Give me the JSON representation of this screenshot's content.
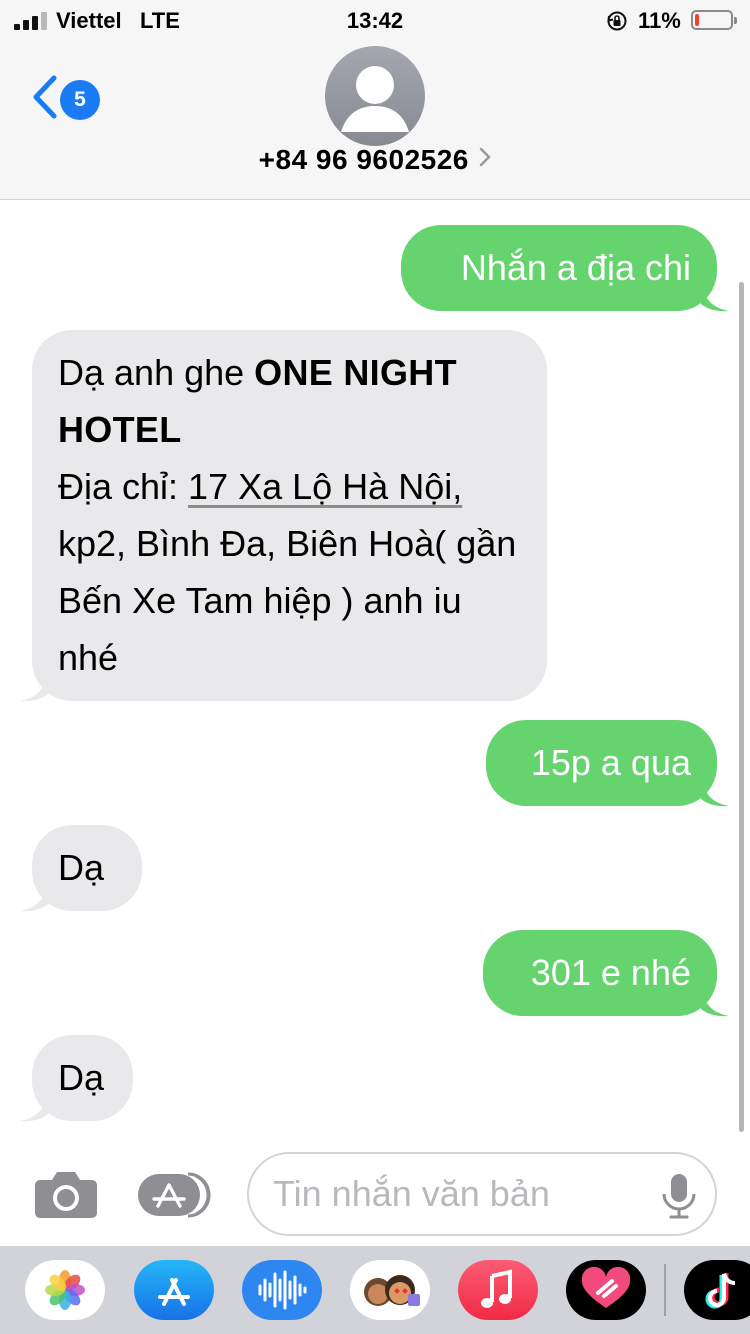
{
  "status_bar": {
    "carrier": "Viettel",
    "network": "LTE",
    "time": "13:42",
    "battery_percent": "11%",
    "battery_level": 0.11,
    "battery_color": "#ff3b30",
    "signal_bars": 3,
    "icons": [
      "signal-icon",
      "orientation-lock-icon",
      "battery-icon"
    ]
  },
  "header": {
    "back_badge_count": "5",
    "contact_name": "+84 96 9602526",
    "accent_color": "#1a7cf5",
    "icons": [
      "back-chevron-icon",
      "contact-avatar-icon",
      "chevron-right-icon"
    ]
  },
  "messages": [
    {
      "direction": "sent",
      "text": "Nhắn a địa chi"
    },
    {
      "direction": "received",
      "intro": "Dạ anh ghe ",
      "bold": "ONE NIGHT HOTEL",
      "address_label": "Địa chỉ: ",
      "address_link": "17 Xa Lộ Hà Nội,",
      "rest": "kp2, Bình Đa, Biên Hoà( gần Bến Xe Tam hiệp ) anh iu nhé"
    },
    {
      "direction": "sent",
      "text": "15p a qua"
    },
    {
      "direction": "received",
      "text": "Dạ"
    },
    {
      "direction": "sent",
      "text": "301 e nhé"
    },
    {
      "direction": "received",
      "text": "Dạ"
    }
  ],
  "colors": {
    "sent_bubble": "#65d36e",
    "received_bubble": "#e9e9eb"
  },
  "compose": {
    "placeholder": "Tin nhắn văn bản",
    "value": "",
    "icons": [
      "camera-icon",
      "app-store-icon",
      "microphone-icon"
    ]
  },
  "app_drawer": {
    "apps": [
      "photos-app-icon",
      "app-store-app-icon",
      "audio-message-icon",
      "memoji-icon",
      "music-app-icon",
      "heart-sticker-app-icon",
      "tiktok-app-icon"
    ]
  }
}
